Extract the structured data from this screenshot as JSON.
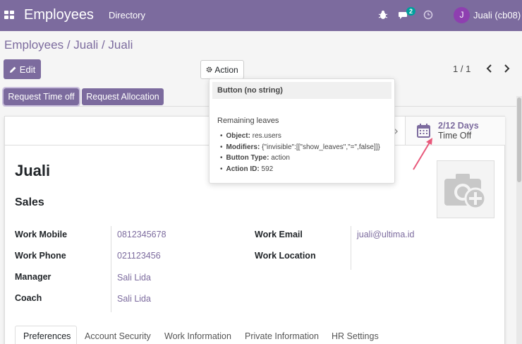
{
  "navbar": {
    "app_title": "Employees",
    "menu_directory": "Directory",
    "chat_count": "2",
    "user_initial": "J",
    "user_name": "Juali (cb08)"
  },
  "breadcrumb": {
    "root": "Employees",
    "sep1": " / ",
    "parent": "Juali",
    "sep2": " / ",
    "current": "Juali"
  },
  "control": {
    "edit_label": "Edit",
    "action_label": "Action",
    "pager": "1 / 1"
  },
  "statusbar": {
    "request_time_off": "Request Time off",
    "request_allocation": "Request Allocation"
  },
  "stat_button": {
    "value": "2/12 Days",
    "label": "Time Off"
  },
  "employee": {
    "name": "Juali",
    "job": "Sales",
    "fields_left": [
      {
        "label": "Work Mobile",
        "value": "0812345678"
      },
      {
        "label": "Work Phone",
        "value": "021123456"
      },
      {
        "label": "Manager",
        "value": "Sali Lida"
      },
      {
        "label": "Coach",
        "value": "Sali Lida"
      }
    ],
    "fields_right": [
      {
        "label": "Work Email",
        "value": "juali@ultima.id"
      },
      {
        "label": "Work Location",
        "value": ""
      }
    ]
  },
  "tabs": [
    "Preferences",
    "Account Security",
    "Work Information",
    "Private Information",
    "HR Settings"
  ],
  "tooltip": {
    "title": "Button (no string)",
    "help": "Remaining leaves",
    "items": [
      {
        "key": "Object:",
        "value": "res.users"
      },
      {
        "key": "Modifiers:",
        "value": "{\"invisible\":[[\"show_leaves\",\"=\",false]]}"
      },
      {
        "key": "Button Type:",
        "value": "action"
      },
      {
        "key": "Action ID:",
        "value": "592"
      }
    ]
  },
  "colors": {
    "brand": "#7c6b9e",
    "badge": "#00a09d",
    "avatar": "#8e3fb0",
    "arrow": "#e8587a"
  },
  "icons": [
    "apps-icon",
    "bug-icon",
    "chat-icon",
    "clock-icon",
    "pencil-icon",
    "gear-icon",
    "chevron-left-icon",
    "chevron-right-icon",
    "calendar-icon",
    "camera-plus-icon"
  ]
}
